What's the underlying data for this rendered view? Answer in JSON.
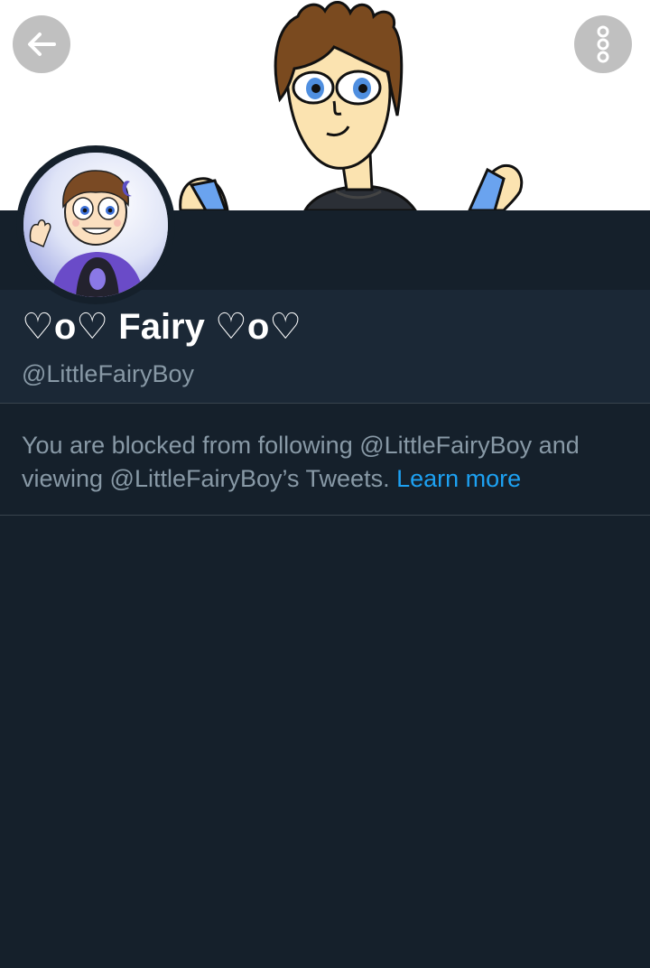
{
  "header": {
    "back_icon": "arrow-left-icon",
    "more_icon": "vertical-dots-icon"
  },
  "profile": {
    "display_name": "♡o♡ Fairy ♡o♡",
    "handle": "@LittleFairyBoy"
  },
  "blocked": {
    "message": "You are blocked from following @LittleFairyBoy and viewing @LittleFairyBoy’s Tweets.",
    "link_label": "Learn more"
  },
  "colors": {
    "background": "#15202b",
    "name_section": "#1b2836",
    "secondary_text": "#8899a6",
    "link": "#1da1f2"
  }
}
